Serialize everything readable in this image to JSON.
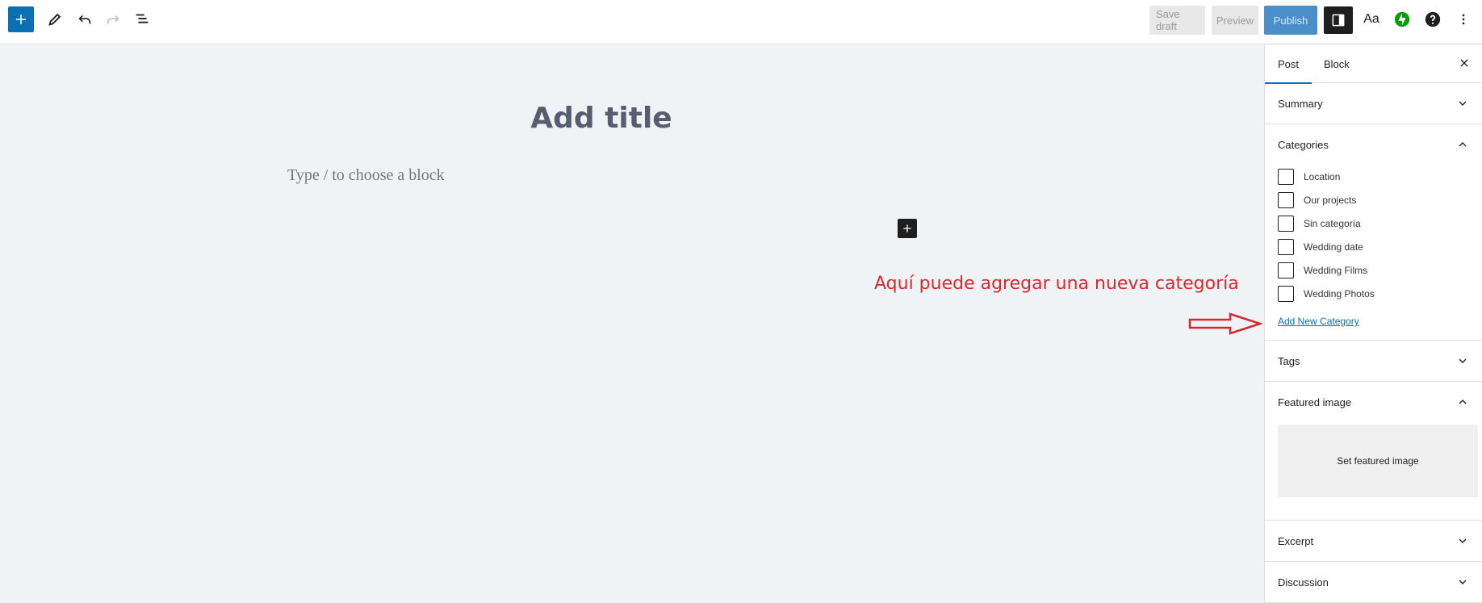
{
  "toolbar": {
    "save_draft": "Save draft",
    "preview": "Preview",
    "publish": "Publish",
    "styles_label": "Aa",
    "icons": [
      "plus-icon",
      "pencil-icon",
      "undo-icon",
      "redo-icon",
      "list-view-icon",
      "sidebar-icon",
      "jetpack-icon",
      "help-icon",
      "more-vertical-icon"
    ]
  },
  "editor": {
    "title_placeholder": "Add title",
    "block_placeholder": "Type / to choose a block",
    "annotation": "Aquí puede agregar una nueva categoría"
  },
  "sidebar": {
    "tabs": [
      "Post",
      "Block"
    ],
    "panels": {
      "summary": "Summary",
      "categories": "Categories",
      "tags": "Tags",
      "featured_image": "Featured image",
      "excerpt": "Excerpt",
      "discussion": "Discussion"
    },
    "categories": [
      "Location",
      "Our projects",
      "Sin categoría",
      "Wedding date",
      "Wedding Films",
      "Wedding Photos"
    ],
    "add_new_category": "Add New Category",
    "set_featured_image": "Set featured image"
  },
  "colors": {
    "accent": "#0a70b4",
    "annotation": "#d82a2e",
    "canvas_bg": "#f0f3f6"
  }
}
